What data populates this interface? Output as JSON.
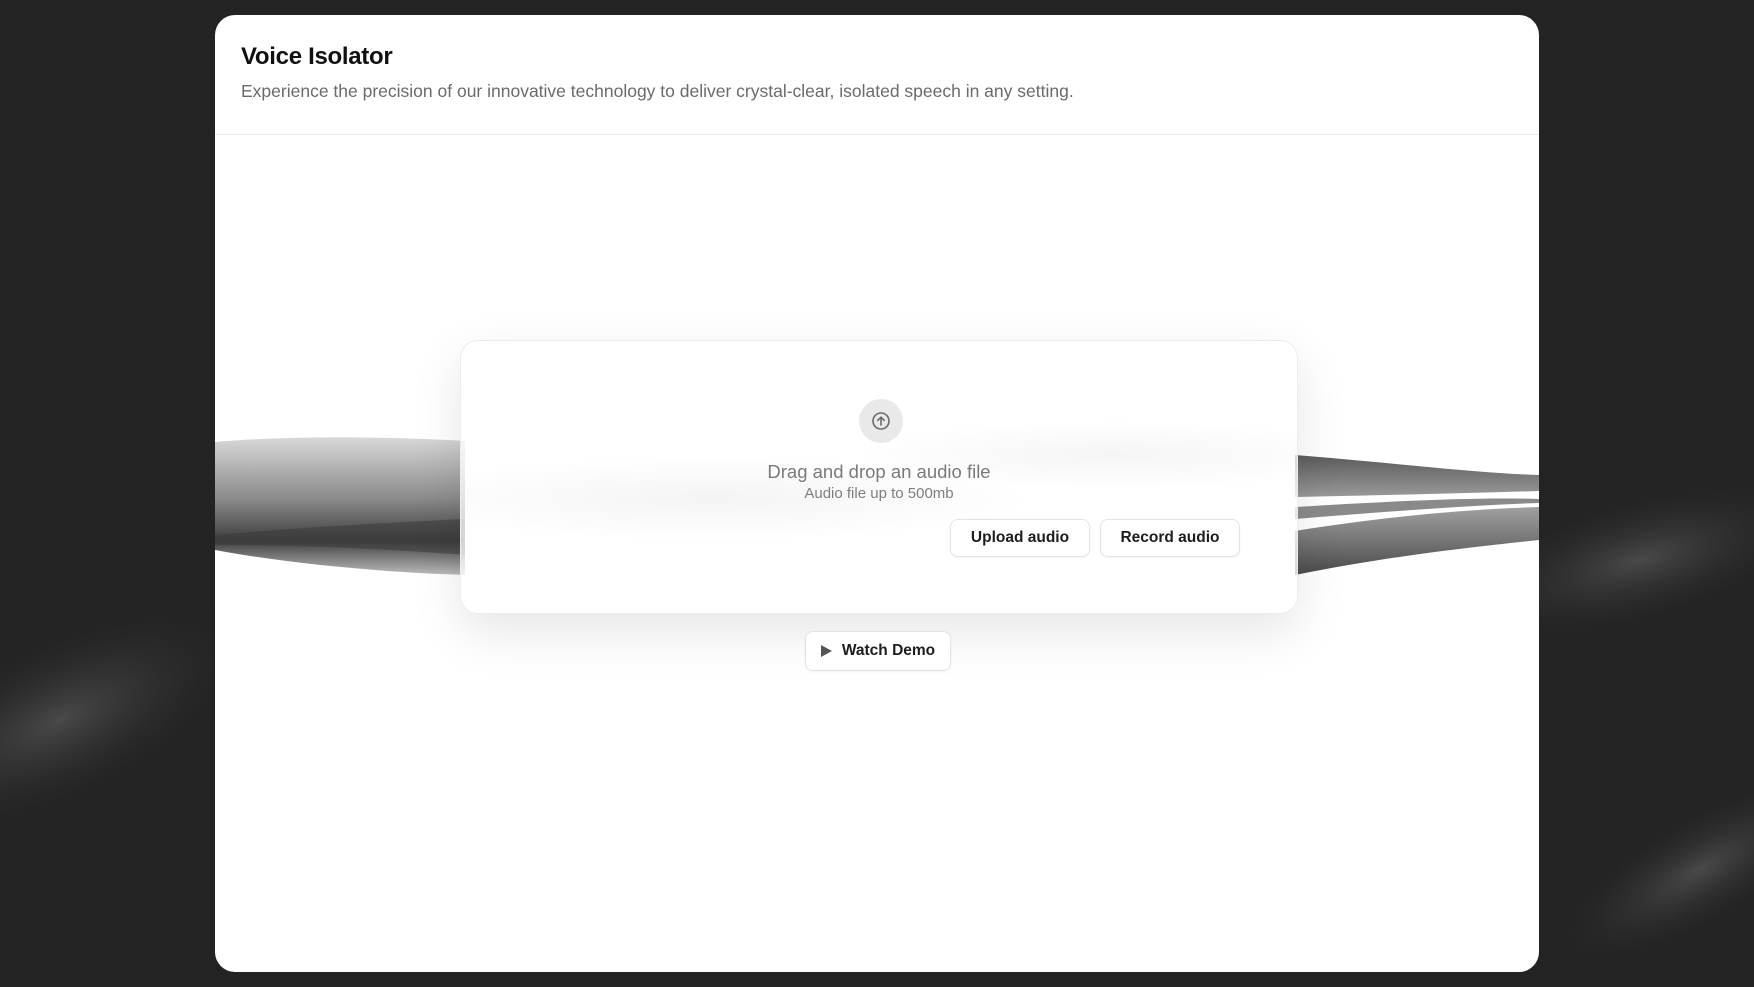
{
  "header": {
    "title": "Voice Isolator",
    "subtitle": "Experience the precision of our innovative technology to deliver crystal-clear, isolated speech in any setting."
  },
  "dropzone": {
    "icon": "upload-arrow-icon",
    "title": "Drag and drop an audio file",
    "subtitle": "Audio file up to 500mb",
    "upload_label": "Upload audio",
    "record_label": "Record audio"
  },
  "demo": {
    "icon": "play-icon",
    "label": "Watch Demo"
  },
  "colors": {
    "page_background": "#232323",
    "panel_background": "#ffffff",
    "accent_dark": "#1d1d1d"
  }
}
